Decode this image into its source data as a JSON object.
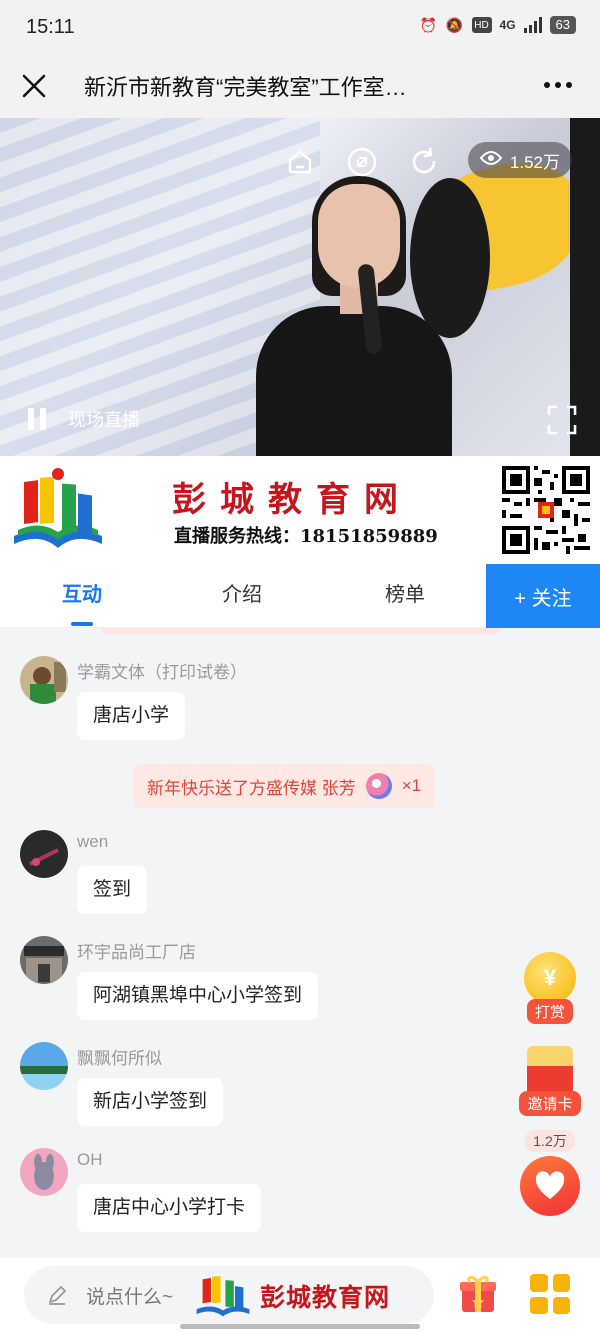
{
  "status_bar": {
    "time": "15:11",
    "network": "4G",
    "hd": "HD",
    "battery": "63"
  },
  "header": {
    "title": "新沂市新教育“完美教室”工作室…"
  },
  "video": {
    "view_count": "1.52万",
    "live_label": "现场直播"
  },
  "banner": {
    "name": "彭城教育网",
    "hotline": "直播服务热线：18151859889"
  },
  "tabs": [
    {
      "label": "互动"
    },
    {
      "label": "介绍"
    },
    {
      "label": "榜单"
    }
  ],
  "follow": {
    "label": "+ 关注"
  },
  "messages": [
    {
      "nick": "学霸文体（打印试卷）",
      "text": "唐店小学"
    },
    {
      "nick": "wen",
      "text": "签到"
    },
    {
      "nick": "环宇品尚工厂店",
      "text": "阿湖镇黑埠中心小学签到"
    },
    {
      "nick": "飘飘何所似",
      "text": "新店小学签到"
    },
    {
      "nick": "OH",
      "text": "唐店中心小学打卡"
    }
  ],
  "gift_notice": {
    "text": "新年快乐送了方盛传媒 张芳",
    "count": "×1"
  },
  "floating": {
    "reward_label": "打赏",
    "invite_label": "邀请卡",
    "like_count": "1.2万",
    "coin_symbol": "¥"
  },
  "bottom": {
    "placeholder": "说点什么~",
    "watermark": "彭城教育网"
  }
}
